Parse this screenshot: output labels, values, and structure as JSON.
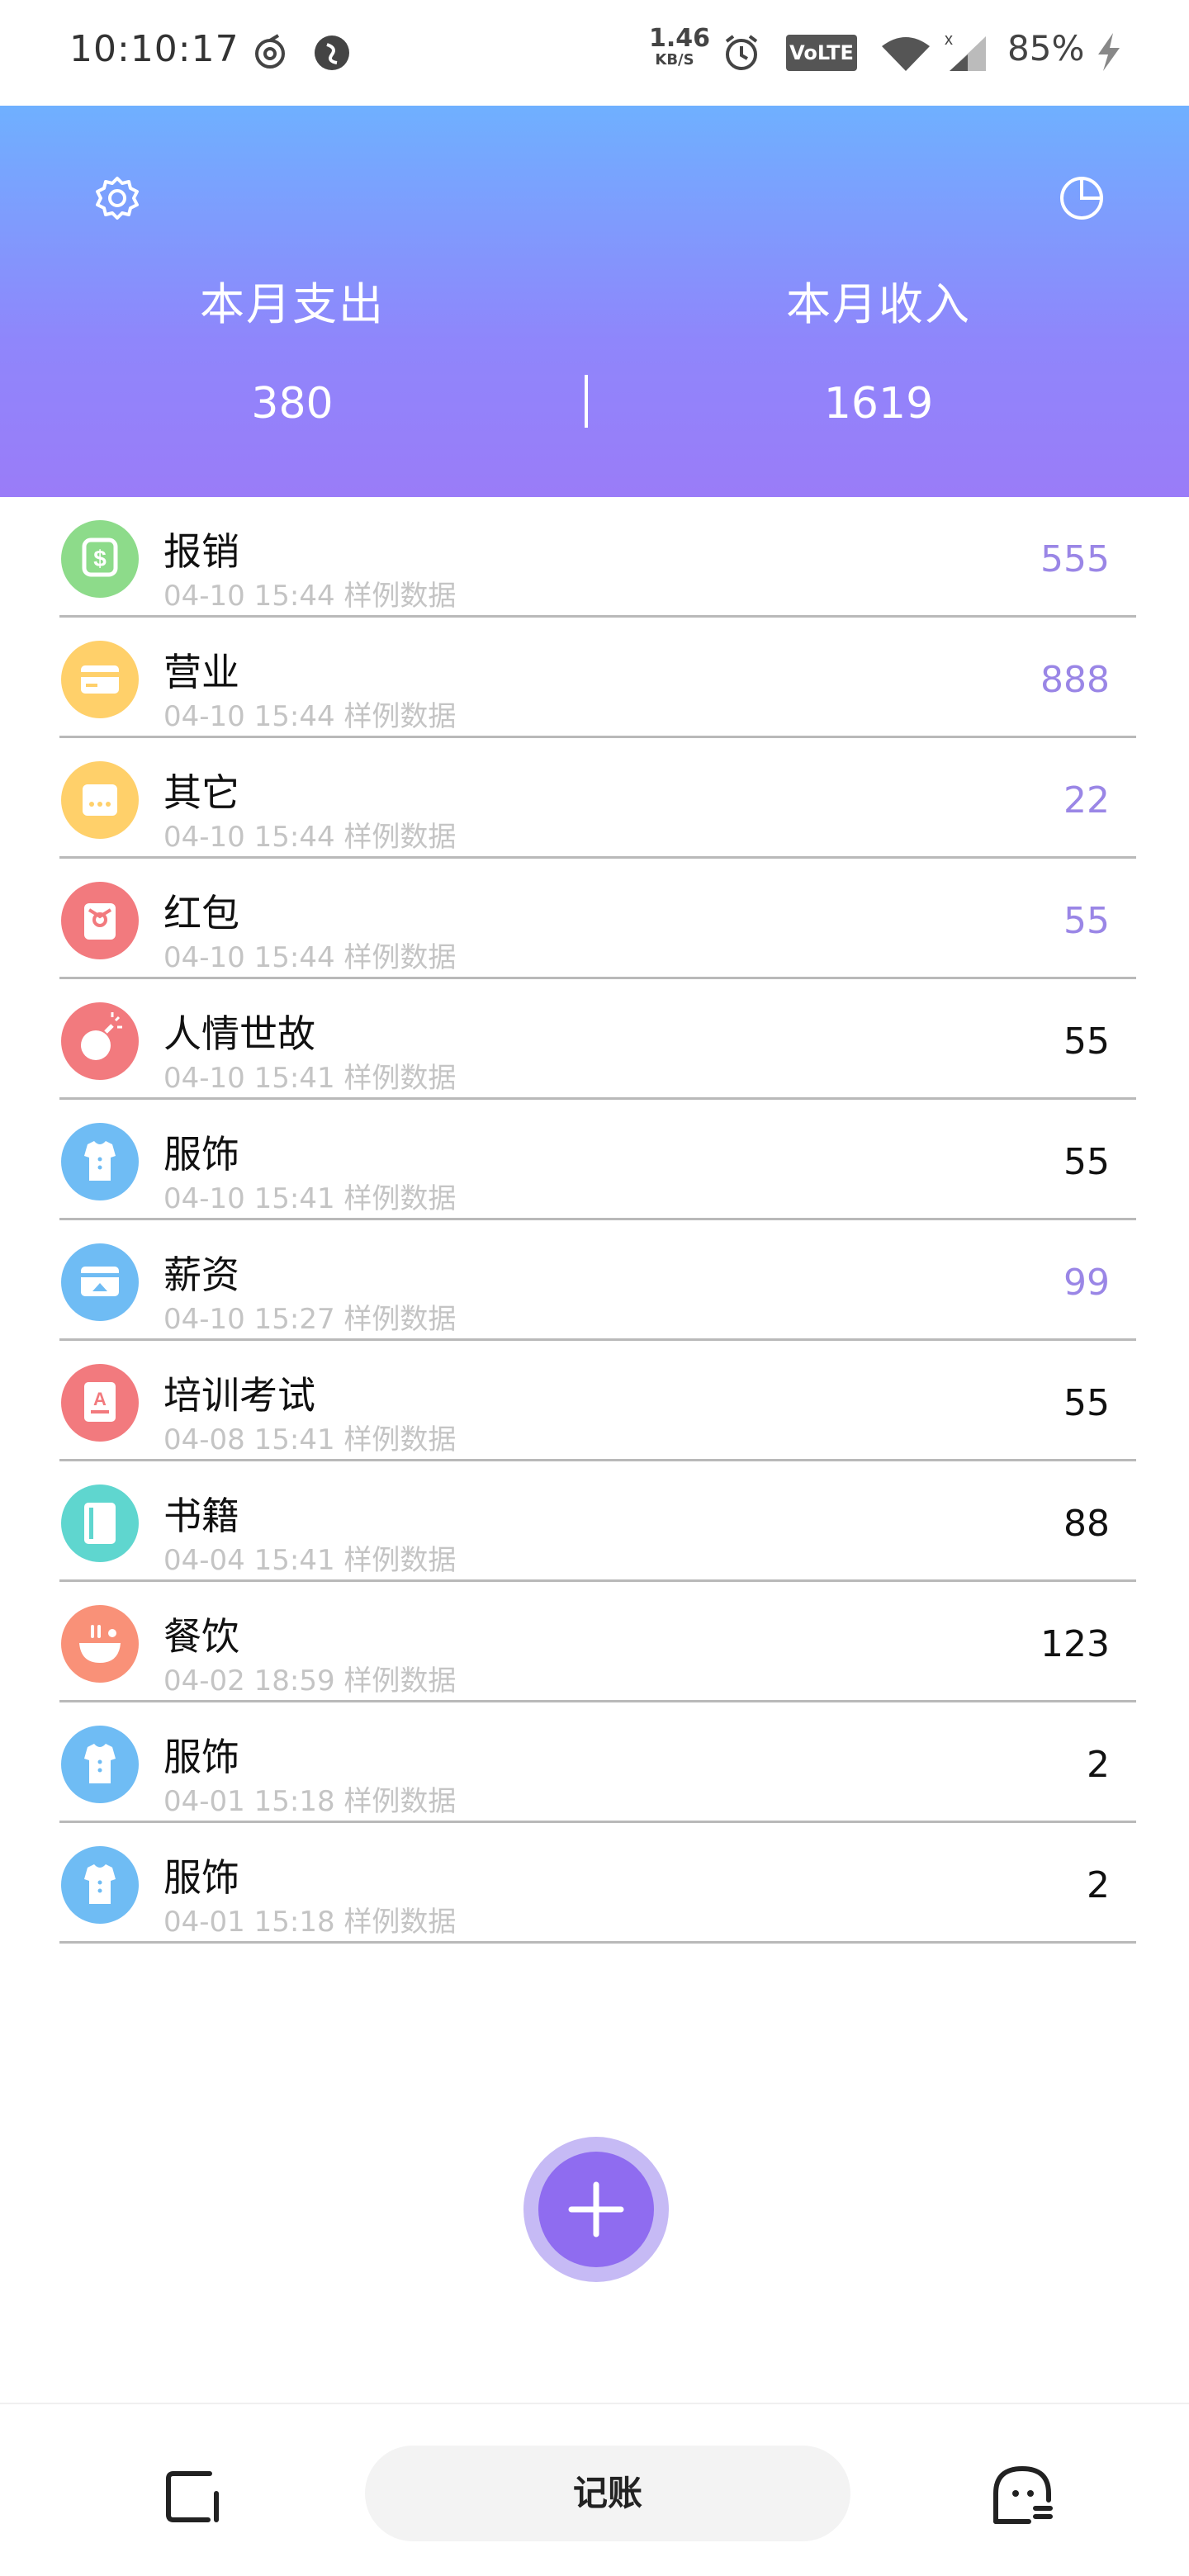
{
  "status_bar": {
    "time": "10:10:17",
    "speed": "1.46",
    "speed_unit": "KB/S",
    "volte": "VoLTE",
    "battery": "85%",
    "icons": [
      "loop-icon",
      "shield-app-icon",
      "alarm-icon",
      "wifi-icon",
      "signal-icon",
      "charging-icon"
    ]
  },
  "header": {
    "settings_icon": "gear-icon",
    "stats_icon": "pie-chart-icon",
    "expense_label": "本月支出",
    "expense_value": "380",
    "income_label": "本月收入",
    "income_value": "1619",
    "colors": {
      "gradient_top": "#6fb0ff",
      "gradient_bottom": "#9a7cf8"
    }
  },
  "records": [
    {
      "title": "报销",
      "time": "04-10 15:44",
      "note": "样例数据",
      "amount": "555",
      "kind": "income",
      "icon": "reimburse-icon",
      "color": "#8ddb8a"
    },
    {
      "title": "营业",
      "time": "04-10 15:44",
      "note": "样例数据",
      "amount": "888",
      "kind": "income",
      "icon": "card-icon",
      "color": "#ffd06a"
    },
    {
      "title": "其它",
      "time": "04-10 15:44",
      "note": "样例数据",
      "amount": "22",
      "kind": "income",
      "icon": "other-icon",
      "color": "#ffd06a"
    },
    {
      "title": "红包",
      "time": "04-10 15:44",
      "note": "样例数据",
      "amount": "55",
      "kind": "income",
      "icon": "red-packet-icon",
      "color": "#f27a7e"
    },
    {
      "title": "人情世故",
      "time": "04-10 15:41",
      "note": "样例数据",
      "amount": "55",
      "kind": "expense",
      "icon": "bomb-icon",
      "color": "#f27a7e"
    },
    {
      "title": "服饰",
      "time": "04-10 15:41",
      "note": "样例数据",
      "amount": "55",
      "kind": "expense",
      "icon": "shirt-icon",
      "color": "#6fbcf4"
    },
    {
      "title": "薪资",
      "time": "04-10 15:27",
      "note": "样例数据",
      "amount": "99",
      "kind": "income",
      "icon": "salary-icon",
      "color": "#6fbcf4"
    },
    {
      "title": "培训考试",
      "time": "04-08 15:41",
      "note": "样例数据",
      "amount": "55",
      "kind": "expense",
      "icon": "exam-icon",
      "color": "#f27a7e"
    },
    {
      "title": "书籍",
      "time": "04-04 15:41",
      "note": "样例数据",
      "amount": "88",
      "kind": "expense",
      "icon": "book-icon",
      "color": "#5fd6cf"
    },
    {
      "title": "餐饮",
      "time": "04-02 18:59",
      "note": "样例数据",
      "amount": "123",
      "kind": "expense",
      "icon": "food-icon",
      "color": "#f99178"
    },
    {
      "title": "服饰",
      "time": "04-01 15:18",
      "note": "样例数据",
      "amount": "2",
      "kind": "expense",
      "icon": "shirt-icon",
      "color": "#6fbcf4"
    },
    {
      "title": "服饰",
      "time": "04-01 15:18",
      "note": "样例数据",
      "amount": "2",
      "kind": "expense",
      "icon": "shirt-icon",
      "color": "#6fbcf4"
    }
  ],
  "fab": {
    "icon": "plus-icon",
    "color": "#8f6cf0"
  },
  "bottom_nav": {
    "left_icon": "bill-list-icon",
    "center_label": "记账",
    "right_icon": "profile-face-icon"
  }
}
